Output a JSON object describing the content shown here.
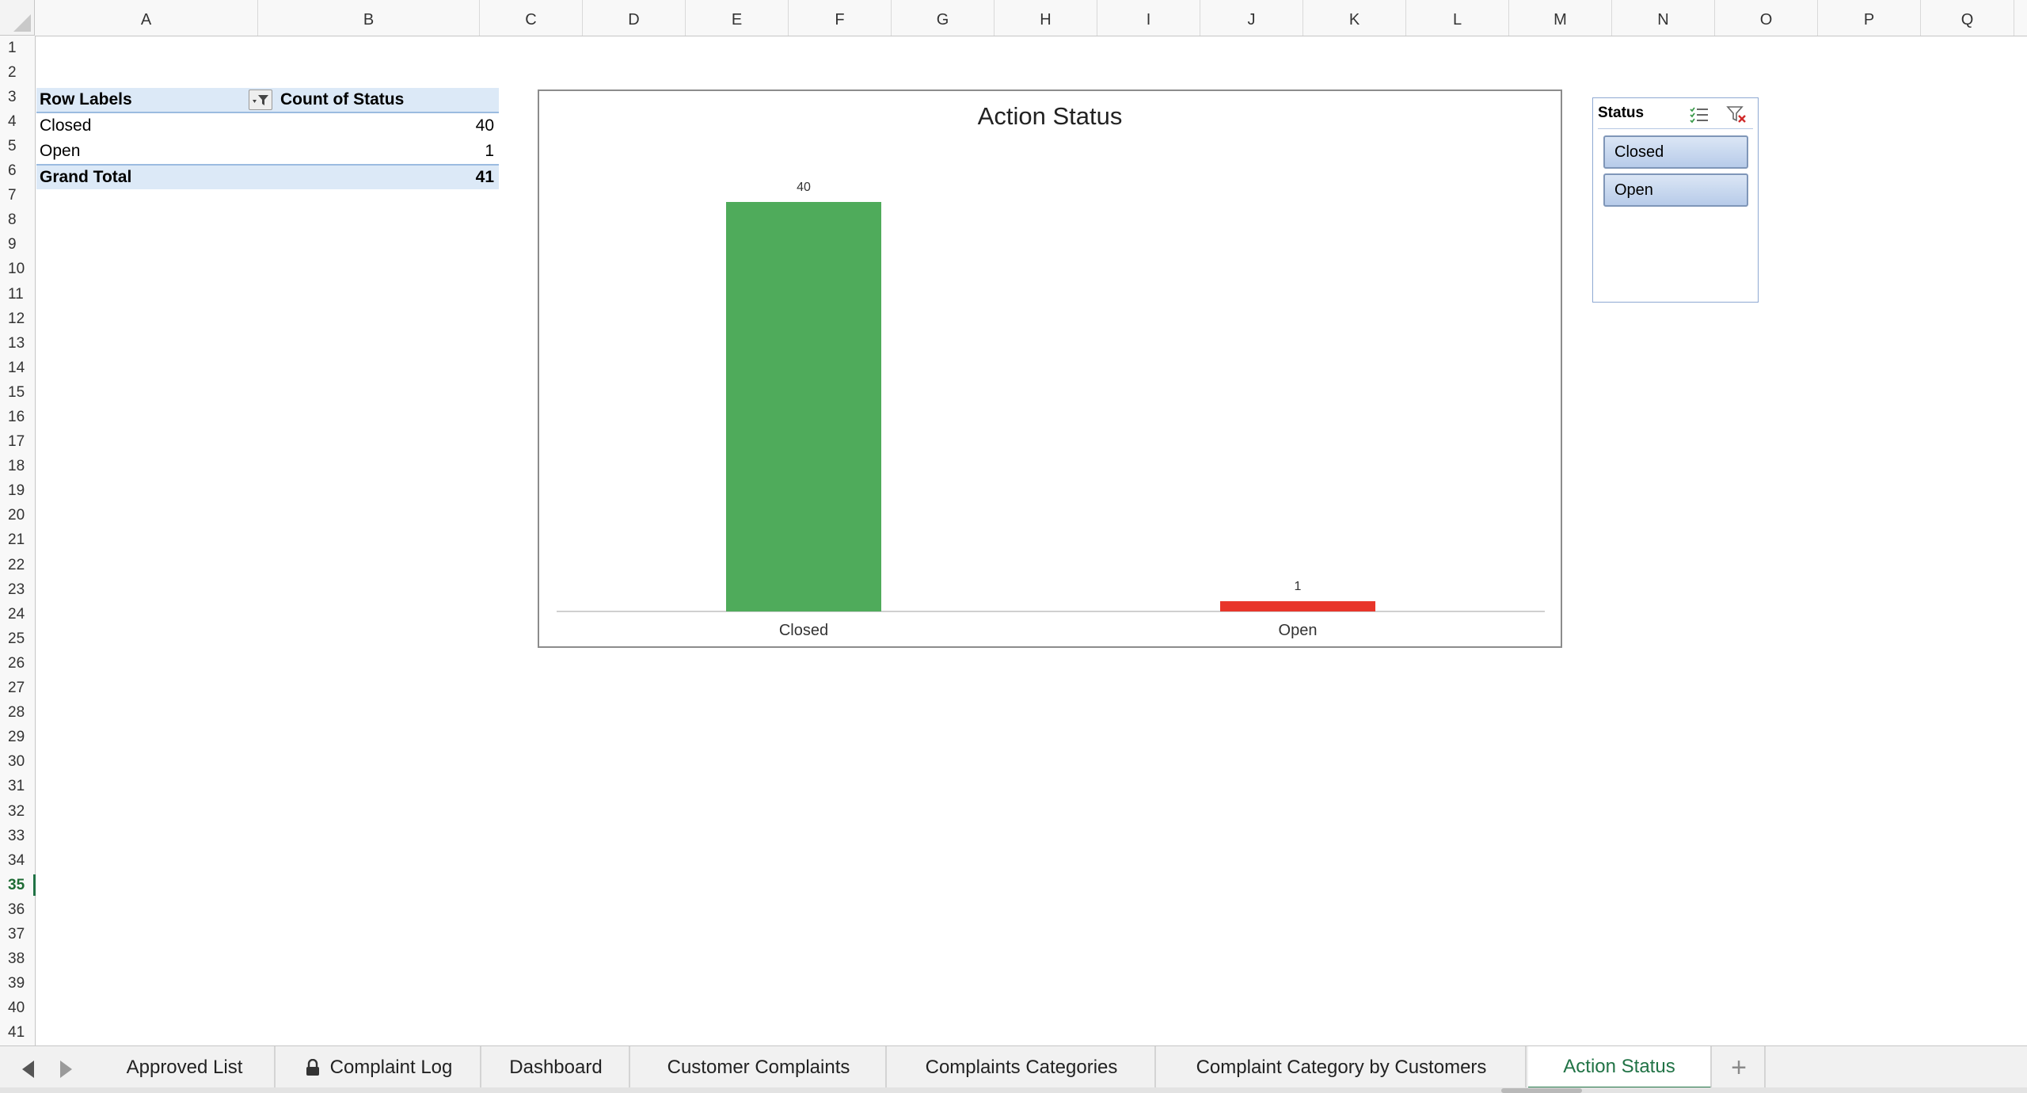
{
  "columns": [
    "A",
    "B",
    "C",
    "D",
    "E",
    "F",
    "G",
    "H",
    "I",
    "J",
    "K",
    "L",
    "M",
    "N",
    "O",
    "P",
    "Q"
  ],
  "rows": [
    "1",
    "2",
    "3",
    "4",
    "5",
    "6",
    "7",
    "8",
    "9",
    "10",
    "11",
    "12",
    "13",
    "14",
    "15",
    "16",
    "17",
    "18",
    "19",
    "20",
    "21",
    "22",
    "23",
    "24",
    "25",
    "26",
    "27",
    "28",
    "29",
    "30",
    "31",
    "32",
    "33",
    "34",
    "35",
    "36",
    "37",
    "38",
    "39",
    "40",
    "41"
  ],
  "active_row": "35",
  "pivot": {
    "header_label": "Row Labels",
    "header_value": "Count of Status",
    "rows": [
      {
        "label": "Closed",
        "value": "40"
      },
      {
        "label": "Open",
        "value": "1"
      }
    ],
    "total_label": "Grand Total",
    "total_value": "41"
  },
  "chart_data": {
    "type": "bar",
    "title": "Action Status",
    "categories": [
      "Closed",
      "Open"
    ],
    "values": [
      40,
      1
    ],
    "data_labels": [
      "40",
      "1"
    ],
    "colors": [
      "#4fab5b",
      "#e8352a"
    ],
    "ylim": [
      0,
      40
    ],
    "grid": false,
    "legend": "none",
    "xlabel": "",
    "ylabel": ""
  },
  "slicer": {
    "title": "Status",
    "items": [
      "Closed",
      "Open"
    ],
    "multi_select_icon": "multi-select-icon",
    "clear_filter_icon": "clear-filter-icon"
  },
  "sheet_tabs": {
    "tabs": [
      {
        "label": "Approved List",
        "locked": false
      },
      {
        "label": "Complaint Log",
        "locked": true
      },
      {
        "label": "Dashboard",
        "locked": false
      },
      {
        "label": "Customer Complaints",
        "locked": false
      },
      {
        "label": "Complaints Categories",
        "locked": false
      },
      {
        "label": "Complaint Category by Customers",
        "locked": false
      },
      {
        "label": "Action Status",
        "locked": false
      }
    ],
    "active": "Action Status",
    "add_label": "+"
  },
  "colors": {
    "accent_green": "#217346",
    "pivot_header_bg": "#dce9f7",
    "bar_closed": "#4fab5b",
    "bar_open": "#e8352a"
  }
}
